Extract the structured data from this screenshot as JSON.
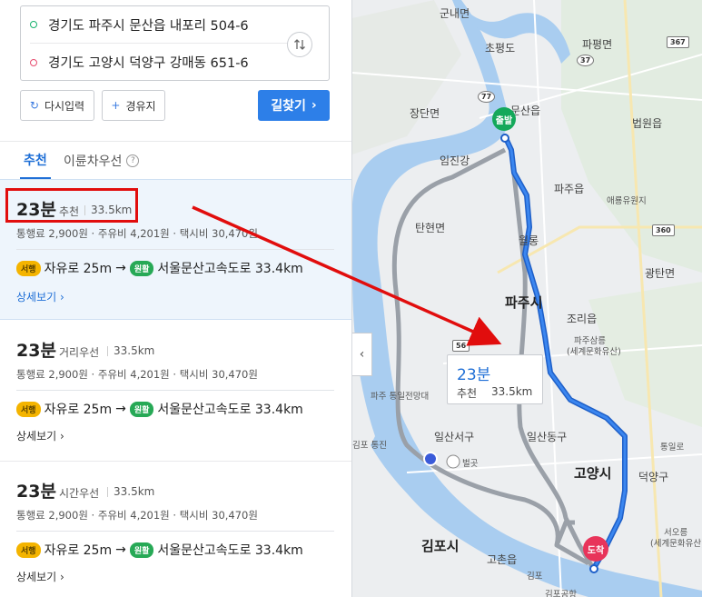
{
  "route": {
    "from": "경기도 파주시 문산읍 내포리 504-6",
    "to": "경기도 고양시 덕양구 강매동 651-6"
  },
  "buttons": {
    "reset": "다시입력",
    "waypoint": "경유지",
    "search": "길찾기"
  },
  "tabs": {
    "recommended": "추천",
    "second": "이륜차우선"
  },
  "cards": [
    {
      "time": "23분",
      "type": "추천",
      "distance": "33.5km",
      "fee": "통행료 2,900원 · 주유비 4,201원 · 택시비 30,470원",
      "seg1_tag": "서행",
      "seg1": "자유로 25m",
      "seg2_tag": "원활",
      "seg2": "서울문산고속도로 33.4km",
      "more": "상세보기"
    },
    {
      "time": "23분",
      "type": "거리우선",
      "distance": "33.5km",
      "fee": "통행료 2,900원 · 주유비 4,201원 · 택시비 30,470원",
      "seg1_tag": "서행",
      "seg1": "자유로 25m",
      "seg2_tag": "원활",
      "seg2": "서울문산고속도로 33.4km",
      "more": "상세보기"
    },
    {
      "time": "23분",
      "type": "시간우선",
      "distance": "33.5km",
      "fee": "통행료 2,900원 · 주유비 4,201원 · 택시비 30,470원",
      "seg1_tag": "서행",
      "seg1": "자유로 25m",
      "seg2_tag": "원활",
      "seg2": "서울문산고속도로 33.4km",
      "more": "상세보기"
    }
  ],
  "map": {
    "popup": {
      "time": "23분",
      "type": "추천",
      "distance": "33.5km"
    },
    "start_pin": "출발",
    "end_pin": "도착",
    "labels": {
      "gunnae": "군내면",
      "chopyeong": "초평도",
      "papyeong": "파평면",
      "jangdan": "장단면",
      "munsan": "문산읍",
      "beobwon": "법원읍",
      "imjingang": "임진강",
      "paju_eup": "파주읍",
      "aeryung": "애룡유원지",
      "tanhyeon": "탄현면",
      "wollong": "월롱",
      "gwangtan": "광탄면",
      "paju_si": "파주시",
      "jori": "조리읍",
      "paju_samreung": "파주삼릉",
      "world_heritage": "(세계문화유산)",
      "paju_tongil": "파주 통일전망대",
      "ilsanseo": "일산서구",
      "ilsandong": "일산동구",
      "goyang": "고양시",
      "deogyang": "덕양구",
      "gimpo_si": "김포시",
      "gimpo_tongjin": "김포 통진",
      "gochon": "고촌읍",
      "gimpo_ic": "김포",
      "gimpo_airport": "김포공항",
      "tongil_ic": "통일로",
      "seooreung": "서오릉",
      "world_heritage2": "(세계문화유산)",
      "beolgot": "벌곳"
    },
    "shields": {
      "r367": "367",
      "r37": "37",
      "r360": "360",
      "r56": "56",
      "r77": "77"
    }
  }
}
